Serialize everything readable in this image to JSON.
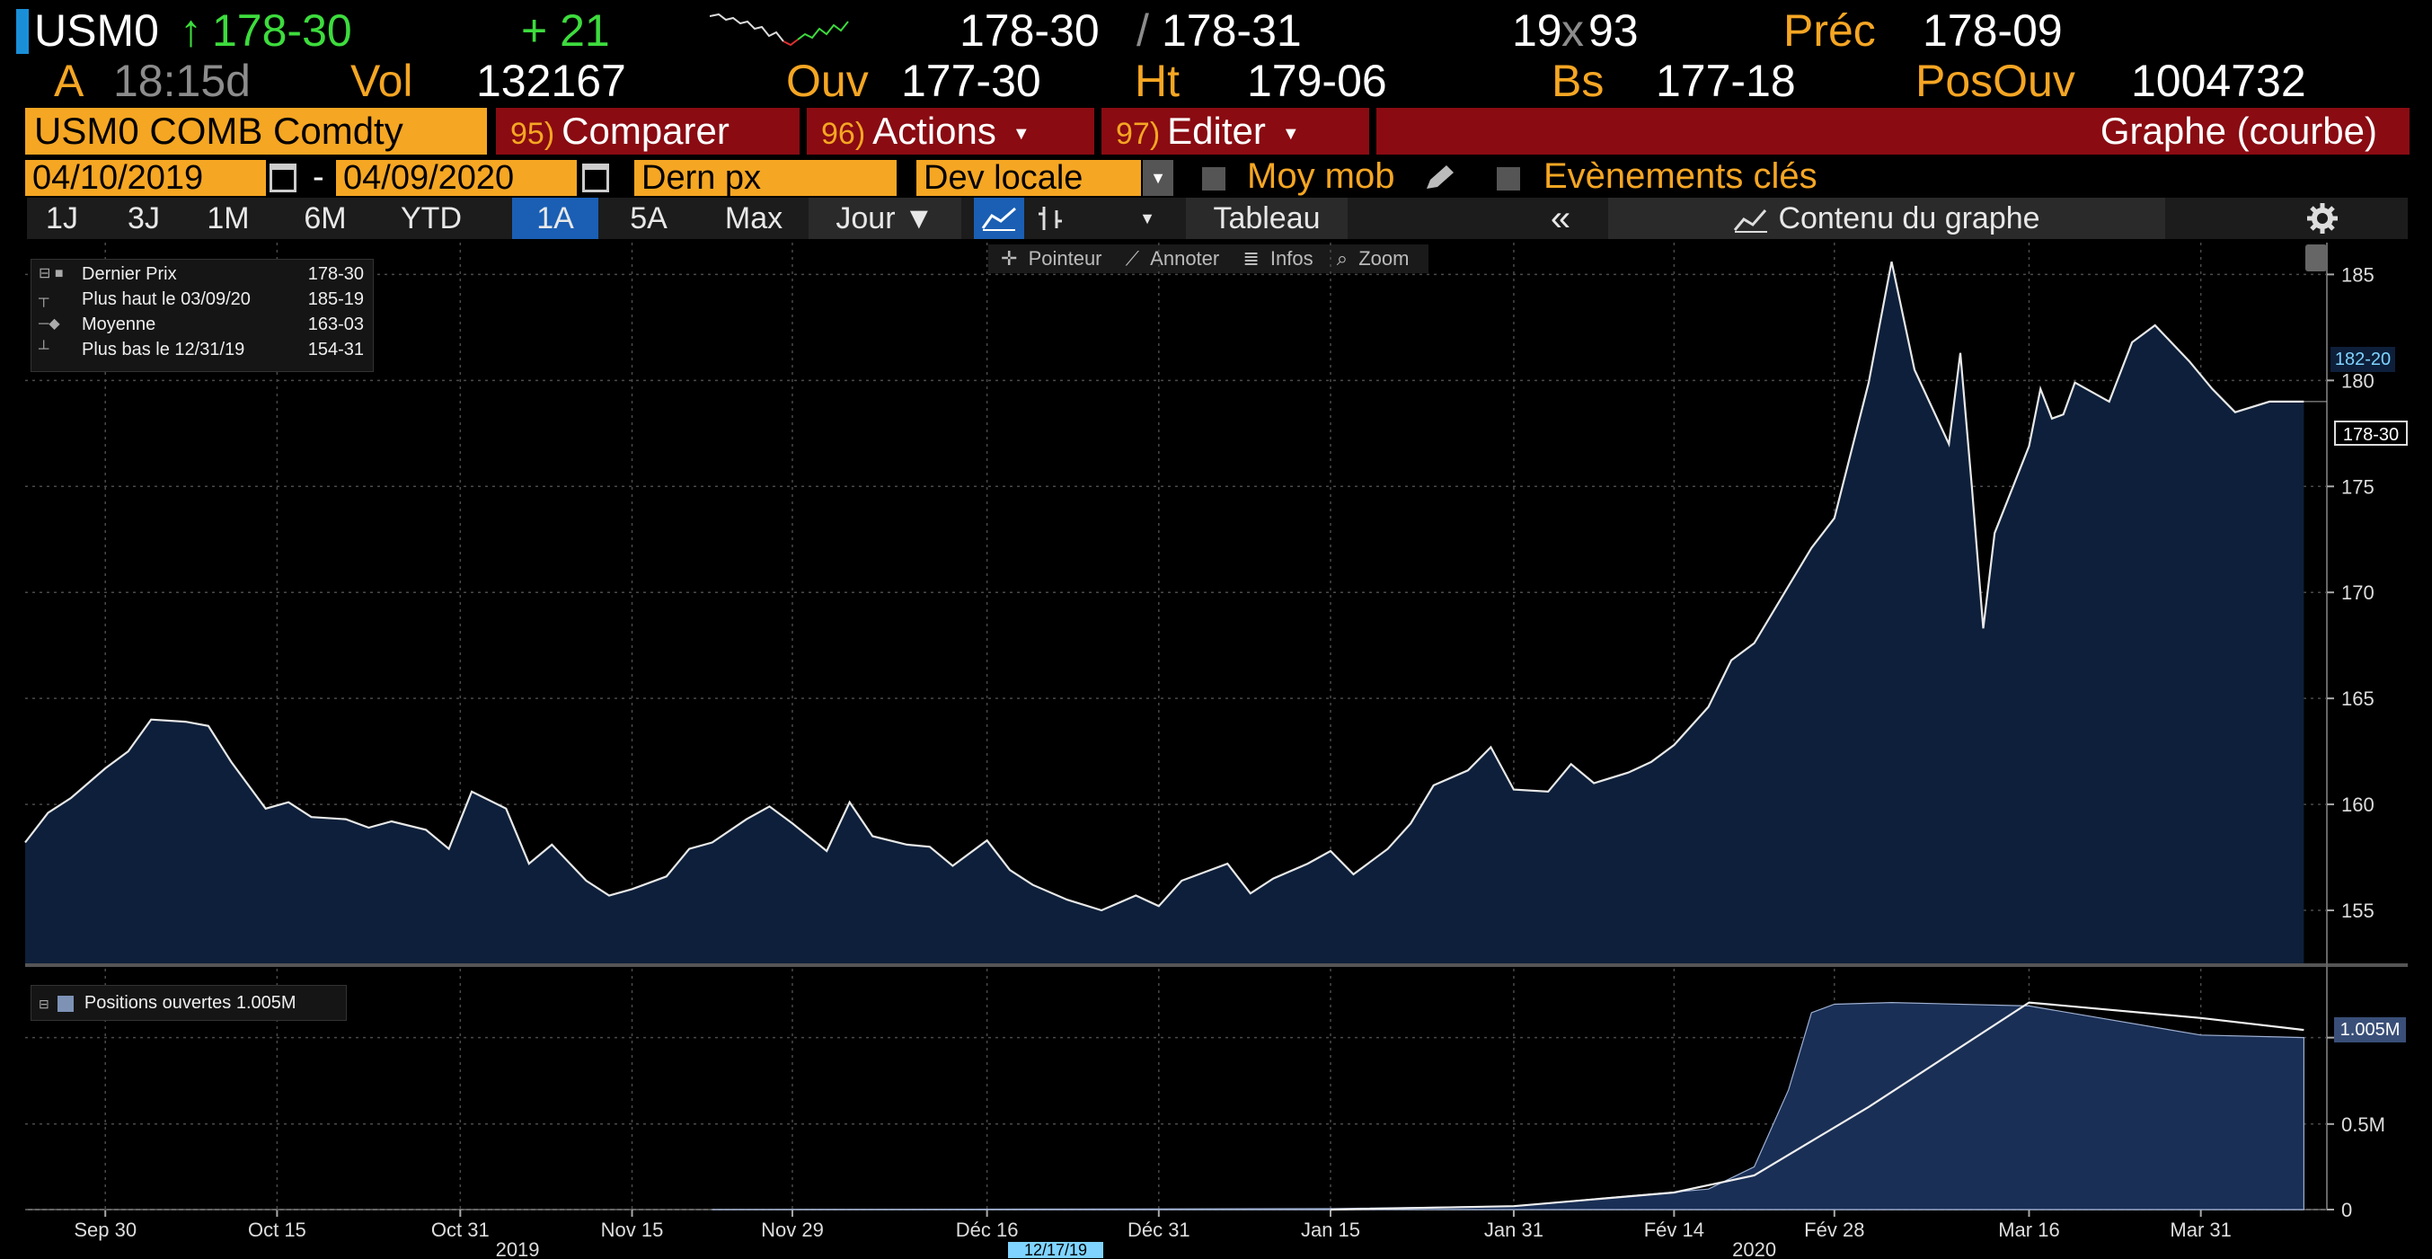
{
  "header": {
    "ticker": "USM0",
    "arrow": "↑",
    "last": "178-30",
    "change": "+ 21",
    "bid": "178-30",
    "slash": "/",
    "ask": "178-31",
    "size_bid": "19",
    "size_x": "x",
    "size_ask": "93",
    "prev_label": "Préc",
    "prev_value": "178-09",
    "a_label": "A",
    "time": "18:15d",
    "vol_label": "Vol",
    "vol_value": "132167",
    "open_label": "Ouv",
    "open_value": "177-30",
    "high_label": "Ht",
    "high_value": "179-06",
    "low_label": "Bs",
    "low_value": "177-18",
    "oi_label": "PosOuv",
    "oi_value": "1004732"
  },
  "action_bar": {
    "security": "USM0 COMB Comdty",
    "compare_num": "95)",
    "compare_label": "Comparer",
    "actions_num": "96)",
    "actions_label": "Actions",
    "edit_num": "97)",
    "edit_label": "Editer",
    "graph_title": "Graphe (courbe)"
  },
  "date_row": {
    "start_date": "04/10/2019",
    "dash": "-",
    "end_date": "04/09/2020",
    "field": "Dern px",
    "currency": "Dev locale",
    "moving_avg": "Moy mob",
    "key_events": "Evènements clés"
  },
  "period_bar": {
    "buttons": [
      "1J",
      "3J",
      "1M",
      "6M",
      "YTD",
      "1A",
      "5A",
      "Max"
    ],
    "selected": "1A",
    "frequency": "Jour ▼",
    "table": "Tableau",
    "collapse": "«",
    "contents": "Contenu du graphe"
  },
  "chart_toolbar": {
    "pointer": "Pointeur",
    "annotate": "Annoter",
    "info": "Infos",
    "zoom": "Zoom"
  },
  "price_legend": {
    "rows": [
      {
        "label": "Dernier Prix",
        "value": "178-30"
      },
      {
        "label": "Plus haut le 03/09/20",
        "value": "185-19"
      },
      {
        "label": "Moyenne",
        "value": "163-03"
      },
      {
        "label": "Plus bas le 12/31/19",
        "value": "154-31"
      }
    ]
  },
  "oi_legend": {
    "label": "Positions ouvertes 1.005M"
  },
  "price_tags": {
    "high_tag": "182-20",
    "last_tag": "178-30",
    "oi_tag": "1.005M"
  },
  "x_axis": {
    "ticks": [
      "Sep 30",
      "Oct 15",
      "Oct 31",
      "Nov 15",
      "Nov 29",
      "Déc 16",
      "Déc 31",
      "Jan 15",
      "Jan 31",
      "Fév 14",
      "Fév 28",
      "Mar 16",
      "Mar 31"
    ],
    "year_labels": [
      "2019",
      "2020"
    ],
    "cursor_date": "12/17/19"
  },
  "colors": {
    "accent_orange": "#f5a623",
    "bar_red": "#8a0b12",
    "change_green": "#3ddc3d",
    "area_fill": "#0d1f3a",
    "selected_blue": "#1a5fb4"
  },
  "chart_data": [
    {
      "type": "area",
      "y_ticks": [
        "155",
        "160",
        "165",
        "170",
        "175",
        "180",
        "185"
      ],
      "ylim": [
        152.5,
        186.5
      ],
      "x_range": [
        "2019-09-23",
        "2020-04-09"
      ],
      "series": [
        {
          "name": "Dernier Prix",
          "x": [
            "2019-09-23",
            "2019-09-25",
            "2019-09-27",
            "2019-09-30",
            "2019-10-02",
            "2019-10-04",
            "2019-10-07",
            "2019-10-09",
            "2019-10-11",
            "2019-10-14",
            "2019-10-16",
            "2019-10-18",
            "2019-10-21",
            "2019-10-23",
            "2019-10-25",
            "2019-10-28",
            "2019-10-30",
            "2019-11-01",
            "2019-11-04",
            "2019-11-06",
            "2019-11-08",
            "2019-11-11",
            "2019-11-13",
            "2019-11-15",
            "2019-11-18",
            "2019-11-20",
            "2019-11-22",
            "2019-11-25",
            "2019-11-27",
            "2019-11-29",
            "2019-12-02",
            "2019-12-04",
            "2019-12-06",
            "2019-12-09",
            "2019-12-11",
            "2019-12-13",
            "2019-12-16",
            "2019-12-18",
            "2019-12-20",
            "2019-12-23",
            "2019-12-26",
            "2019-12-29",
            "2019-12-31",
            "2020-01-02",
            "2020-01-06",
            "2020-01-08",
            "2020-01-10",
            "2020-01-13",
            "2020-01-15",
            "2020-01-17",
            "2020-01-20",
            "2020-01-22",
            "2020-01-24",
            "2020-01-27",
            "2020-01-29",
            "2020-01-31",
            "2020-02-03",
            "2020-02-05",
            "2020-02-07",
            "2020-02-10",
            "2020-02-12",
            "2020-02-14",
            "2020-02-17",
            "2020-02-19",
            "2020-02-21",
            "2020-02-24",
            "2020-02-26",
            "2020-02-28",
            "2020-03-02",
            "2020-03-04",
            "2020-03-06",
            "2020-03-09",
            "2020-03-10",
            "2020-03-11",
            "2020-03-12",
            "2020-03-13",
            "2020-03-16",
            "2020-03-17",
            "2020-03-18",
            "2020-03-19",
            "2020-03-20",
            "2020-03-23",
            "2020-03-25",
            "2020-03-27",
            "2020-03-30",
            "2020-04-01",
            "2020-04-03",
            "2020-04-06",
            "2020-04-08",
            "2020-04-09"
          ],
          "y": [
            158.2,
            159.6,
            160.3,
            161.7,
            162.5,
            164.0,
            163.9,
            163.7,
            162.0,
            159.8,
            160.1,
            159.4,
            159.3,
            158.9,
            159.2,
            158.8,
            157.9,
            160.6,
            159.8,
            157.2,
            158.1,
            156.4,
            155.7,
            156.0,
            156.6,
            157.9,
            158.2,
            159.3,
            159.9,
            159.1,
            157.8,
            160.1,
            158.5,
            158.1,
            158.0,
            157.1,
            158.3,
            156.9,
            156.2,
            155.5,
            155.0,
            155.7,
            155.2,
            156.4,
            157.2,
            155.8,
            156.5,
            157.2,
            157.8,
            156.7,
            157.9,
            159.1,
            160.9,
            161.6,
            162.7,
            160.7,
            160.6,
            161.9,
            161.0,
            161.5,
            162.0,
            162.8,
            164.6,
            166.8,
            167.6,
            170.3,
            172.1,
            173.5,
            179.9,
            185.6,
            180.5,
            177.0,
            181.3,
            175.0,
            168.3,
            172.8,
            176.9,
            179.6,
            178.2,
            178.4,
            179.9,
            179.0,
            181.8,
            182.6,
            180.9,
            179.6,
            178.5,
            179.0,
            179.0,
            179.0
          ]
        }
      ]
    },
    {
      "type": "area",
      "title": "Positions ouvertes",
      "y_ticks": [
        "0",
        "0.5M",
        "1.005M"
      ],
      "ylim": [
        0,
        1.25
      ],
      "series": [
        {
          "name": "Positions ouvertes",
          "x": [
            "2019-11-22",
            "2020-01-15",
            "2020-01-31",
            "2020-02-10",
            "2020-02-17",
            "2020-02-21",
            "2020-02-24",
            "2020-02-26",
            "2020-02-28",
            "2020-03-04",
            "2020-03-16",
            "2020-03-31",
            "2020-04-09"
          ],
          "y": [
            0.0,
            0.005,
            0.02,
            0.08,
            0.12,
            0.25,
            0.7,
            1.15,
            1.2,
            1.21,
            1.19,
            1.02,
            1.005
          ]
        },
        {
          "type": "line",
          "x": [
            "2020-01-15",
            "2020-01-31",
            "2020-02-14",
            "2020-02-21",
            "2020-03-02",
            "2020-03-16",
            "2020-03-31",
            "2020-04-09"
          ],
          "y": [
            0.0,
            0.02,
            0.1,
            0.2,
            0.6,
            1.21,
            1.12,
            1.05
          ]
        }
      ]
    }
  ]
}
